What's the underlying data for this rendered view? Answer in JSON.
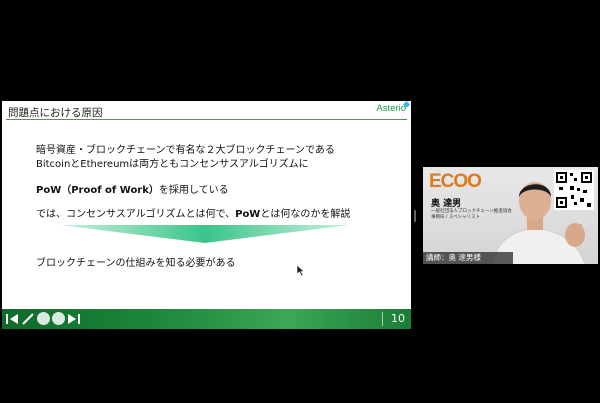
{
  "slide": {
    "title": "問題点における原因",
    "logo": "Asterio",
    "lines": {
      "l1": "暗号資産・ブロックチェーンで有名な２大ブロックチェーンである",
      "l2": "BitcoinとEthereumは両方ともコンセンサスアルゴリズムに",
      "l3a": "PoW（Proof of Work）",
      "l3b": "を採用している",
      "l4a": "では、コンセンサスアルゴリズムとは何で、",
      "l4b": "PoW",
      "l4c": "とは何なのかを解説",
      "l6": "ブロックチェーンの仕組みを知る必要がある"
    },
    "page_number": "10",
    "colors": {
      "accent": "#1aa04a",
      "footer": "#1d8a3c",
      "arrow": "#5bd49a"
    }
  },
  "video": {
    "org_logo": "ECOO",
    "name": "奥 達男",
    "subtitle_1": "一般社団法人ブロックチェーン推進協会",
    "subtitle_2": "事務局 / スペシャリスト",
    "caption": "講師：奥 達男様"
  }
}
